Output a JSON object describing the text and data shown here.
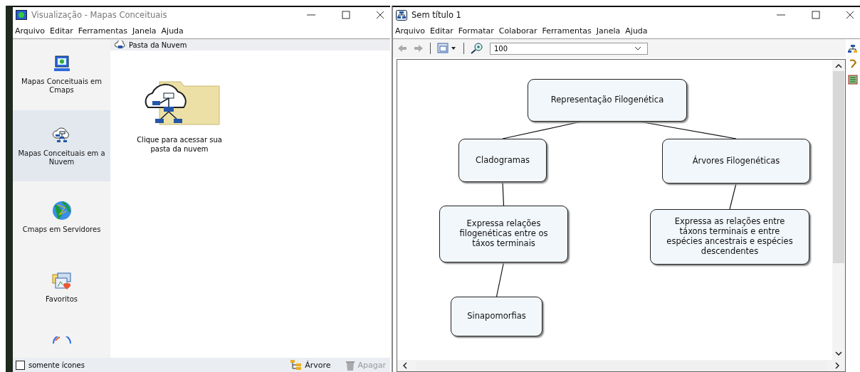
{
  "left_window": {
    "title": "Visualização - Mapas Conceituais",
    "menu": [
      "Arquivo",
      "Editar",
      "Ferramentas",
      "Janela",
      "Ajuda"
    ],
    "sidebar": {
      "items": [
        {
          "kind": "computer",
          "label": "Mapas Conceituais em Cmaps",
          "selected": false
        },
        {
          "kind": "cloud",
          "label": "Mapas Conceituais em a Nuvem",
          "selected": true
        },
        {
          "kind": "globe",
          "label": "Cmaps em Servidores",
          "selected": false
        },
        {
          "kind": "favorites",
          "label": "Favoritos",
          "selected": false
        },
        {
          "kind": "partial"
        }
      ]
    },
    "folder_header": "Pasta da Nuvem",
    "folder_item": "Clique para acessar sua pasta da nuvem",
    "bottom_bar": {
      "checkbox": {
        "label": "somente ícones",
        "checked": false
      },
      "buttons": [
        {
          "kind": "tree",
          "label": "Árvore",
          "disabled": false
        },
        {
          "kind": "trash",
          "label": "Apagar",
          "disabled": true
        }
      ]
    }
  },
  "right_window": {
    "title": "Sem título 1",
    "menu": [
      "Arquivo",
      "Editar",
      "Formatar",
      "Colaborar",
      "Ferramentas",
      "Janela",
      "Ajuda"
    ],
    "toolbar": {
      "zoom": "100"
    },
    "concept_map": {
      "nodes": [
        {
          "text": "Representação Filogenética"
        },
        {
          "text": "Cladogramas"
        },
        {
          "text": "Árvores Filogenéticas"
        },
        {
          "text": "Expressa relações filogenéticas entre os táxos terminais"
        },
        {
          "text": "Expressa as relações entre táxons terminais e entre espécies ancestrais e espécies descendentes"
        },
        {
          "text": "Sinapomorfias"
        }
      ]
    }
  }
}
